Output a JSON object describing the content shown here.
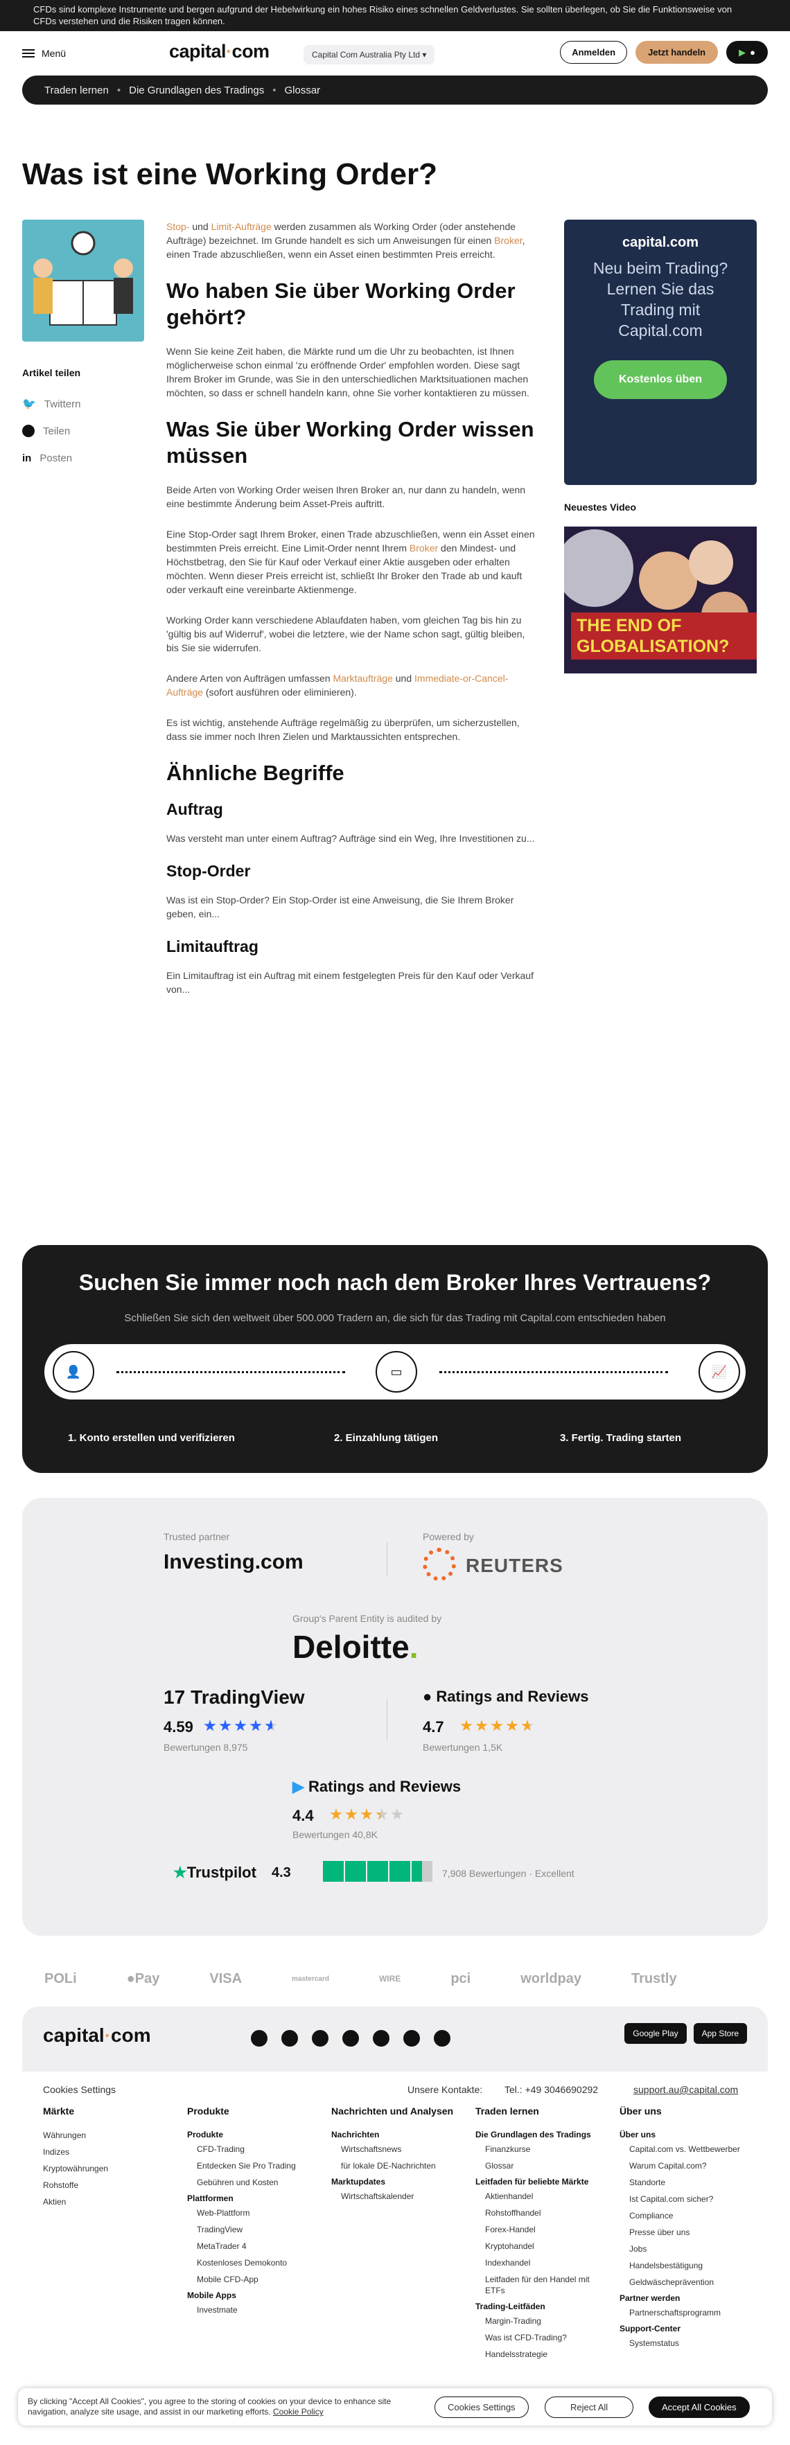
{
  "risk_banner": "CFDs sind komplexe Instrumente und bergen aufgrund der Hebelwirkung ein hohes Risiko eines schnellen Geldverlustes. Sie sollten überlegen, ob Sie die Funktionsweise von CFDs verstehen und die Risiken tragen können.",
  "nav": {
    "menu": "Menü",
    "logo": "capital",
    "logo_tail": "com",
    "entity": "Capital Com Australia Pty Ltd",
    "login": "Anmelden",
    "trade": "Jetzt handeln"
  },
  "breadcrumb": [
    "Traden lernen",
    "Die Grundlagen des Tradings",
    "Glossar"
  ],
  "title": "Was ist eine Working Order?",
  "share": {
    "heading": "Artikel teilen",
    "twitter": "Twittern",
    "facebook": "Teilen",
    "linkedin": "Posten"
  },
  "article": {
    "intro_a": "Stop-",
    "intro_b": " und ",
    "intro_c": "Limit-Aufträge",
    "intro_d": " werden zusammen als Working Order (oder anstehende Aufträge) bezeichnet. Im Grunde handelt es sich um Anweisungen für einen ",
    "intro_e": "Broker",
    "intro_f": ", einen Trade abzuschließen, wenn ein Asset einen bestimmten Preis erreicht.",
    "h2_1": "Wo haben Sie über Working Order gehört?",
    "p1": "Wenn Sie keine Zeit haben, die Märkte rund um die Uhr zu beobachten, ist Ihnen möglicherweise schon einmal 'zu eröffnende Order' empfohlen worden. Diese sagt Ihrem Broker im Grunde, was Sie in den unterschiedlichen Marktsituationen machen möchten, so dass er schnell handeln kann, ohne Sie vorher kontaktieren zu müssen.",
    "h2_2": "Was Sie über Working Order wissen müssen",
    "p2": "Beide Arten von Working Order weisen Ihren Broker an, nur dann zu handeln, wenn eine bestimmte Änderung beim Asset-Preis auftritt.",
    "p3a": "Eine Stop-Order sagt Ihrem Broker, einen Trade abzuschließen, wenn ein Asset einen bestimmten Preis erreicht. Eine Limit-Order nennt Ihrem ",
    "p3b": "Broker",
    "p3c": " den Mindest- und Höchstbetrag, den Sie für Kauf oder Verkauf einer Aktie ausgeben oder erhalten möchten. Wenn dieser Preis erreicht ist, schließt Ihr Broker den Trade ab und kauft oder verkauft eine vereinbarte Aktienmenge.",
    "p4": "Working Order kann verschiedene Ablaufdaten haben, vom gleichen Tag bis hin zu 'gültig bis auf Widerruf', wobei die letztere, wie der Name schon sagt, gültig bleiben, bis Sie sie widerrufen.",
    "p5a": "Andere Arten von Aufträgen umfassen ",
    "p5b": "Marktaufträge",
    "p5c": " und ",
    "p5d": "Immediate-or-Cancel-Aufträge",
    "p5e": " (sofort ausführen oder eliminieren).",
    "p6": "Es ist wichtig, anstehende Aufträge regelmäßig zu überprüfen, um sicherzustellen, dass sie immer noch Ihren Zielen und Marktaussichten entsprechen.",
    "h2_3": "Ähnliche Begriffe",
    "terms": [
      {
        "t": "Auftrag",
        "d": "Was versteht man unter einem Auftrag? Aufträge sind ein Weg, Ihre Investitionen zu..."
      },
      {
        "t": "Stop-Order",
        "d": "Was ist ein Stop-Order? Ein Stop-Order ist eine Anweisung, die Sie Ihrem Broker geben, ein..."
      },
      {
        "t": "Limitauftrag",
        "d": "Ein Limitauftrag ist ein Auftrag mit einem festgelegten Preis für den Kauf oder Verkauf von..."
      }
    ]
  },
  "promo": {
    "logo": "capital.com",
    "text": "Neu beim Trading? Lernen Sie das Trading mit Capital.com",
    "button": "Kostenlos üben"
  },
  "video": {
    "heading": "Neuestes Video",
    "title": "THE END OF GLOBALISATION?"
  },
  "broker": {
    "title": "Suchen Sie immer noch nach dem Broker Ihres Vertrauens?",
    "sub": "Schließen Sie sich den weltweit über 500.000 Tradern an, die sich für das Trading mit Capital.com entschieden haben",
    "steps": [
      "1. Konto erstellen und verifizieren",
      "2. Einzahlung tätigen",
      "3. Fertig. Trading starten"
    ]
  },
  "trust": {
    "trusted": "Trusted partner",
    "investing": "Investing.com",
    "powered": "Powered by",
    "reuters": "REUTERS",
    "audited": "Group's Parent Entity is audited by",
    "deloitte": "Deloitte",
    "tv": {
      "name": "TradingView",
      "score": "4.59",
      "count": "Bewertungen 8,975"
    },
    "apple": {
      "name": "Ratings and Reviews",
      "score": "4.7",
      "count": "Bewertungen 1,5K"
    },
    "google": {
      "name": "Ratings and Reviews",
      "score": "4.4",
      "count": "Bewertungen 40,8K"
    },
    "trustpilot": {
      "name": "Trustpilot",
      "score": "4.3",
      "count": "7,908 Bewertungen",
      "label": "Excellent"
    }
  },
  "payments": [
    "POLi",
    "Pay",
    "VISA",
    "mastercard",
    "WIRE",
    "pci",
    "worldpay",
    "Trustly"
  ],
  "footer": {
    "logo": "capital",
    "logo_tail": "com",
    "stores": [
      "Google Play",
      "App Store"
    ],
    "cookie_settings": "Cookies Settings",
    "contacts": "Unsere Kontakte:",
    "phone": "Tel.: +49 3046690292",
    "email": "support.au@capital.com",
    "cols": [
      {
        "h": "Märkte",
        "items": [
          {
            "t": "Währungen"
          },
          {
            "t": "Indizes"
          },
          {
            "t": "Kryptowährungen"
          },
          {
            "t": "Rohstoffe"
          },
          {
            "t": "Aktien"
          }
        ]
      },
      {
        "h": "Produkte",
        "items": [
          {
            "t": "Produkte",
            "s": true
          },
          {
            "t": "CFD-Trading",
            "i": true
          },
          {
            "t": "Entdecken Sie Pro Trading",
            "i": true
          },
          {
            "t": "Gebühren und Kosten",
            "i": true
          },
          {
            "t": "Plattformen",
            "s": true
          },
          {
            "t": "Web-Plattform",
            "i": true
          },
          {
            "t": "TradingView",
            "i": true
          },
          {
            "t": "MetaTrader 4",
            "i": true
          },
          {
            "t": "Kostenloses Demokonto",
            "i": true
          },
          {
            "t": "Mobile CFD-App",
            "i": true
          },
          {
            "t": "Mobile Apps",
            "s": true
          },
          {
            "t": "Investmate",
            "i": true
          }
        ]
      },
      {
        "h": "Nachrichten und Analysen",
        "items": [
          {
            "t": "Nachrichten",
            "s": true
          },
          {
            "t": "Wirtschaftsnews",
            "i": true
          },
          {
            "t": "für lokale DE-Nachrichten",
            "i": true
          },
          {
            "t": "Marktupdates",
            "s": true
          },
          {
            "t": "Wirtschaftskalender",
            "i": true
          }
        ]
      },
      {
        "h": "Traden lernen",
        "items": [
          {
            "t": "Die Grundlagen des Tradings",
            "s": true
          },
          {
            "t": "Finanzkurse",
            "i": true
          },
          {
            "t": "Glossar",
            "i": true
          },
          {
            "t": "Leitfaden für beliebte Märkte",
            "s": true
          },
          {
            "t": "Aktienhandel",
            "i": true
          },
          {
            "t": "Rohstoffhandel",
            "i": true
          },
          {
            "t": "Forex-Handel",
            "i": true
          },
          {
            "t": "Kryptohandel",
            "i": true
          },
          {
            "t": "Indexhandel",
            "i": true
          },
          {
            "t": "Leitfaden für den Handel mit ETFs",
            "i": true
          },
          {
            "t": "Trading-Leitfäden",
            "s": true
          },
          {
            "t": "Margin-Trading",
            "i": true
          },
          {
            "t": "Was ist CFD-Trading?",
            "i": true
          },
          {
            "t": "Handelsstrategie",
            "i": true
          }
        ]
      },
      {
        "h": "Über uns",
        "items": [
          {
            "t": "Über uns",
            "s": true
          },
          {
            "t": "Capital.com vs. Wettbewerber",
            "i": true
          },
          {
            "t": "Warum Capital.com?",
            "i": true
          },
          {
            "t": "Standorte",
            "i": true
          },
          {
            "t": "Ist Capital.com sicher?",
            "i": true
          },
          {
            "t": "Compliance",
            "i": true
          },
          {
            "t": "Presse über uns",
            "i": true
          },
          {
            "t": "Jobs",
            "i": true
          },
          {
            "t": "Handelsbestätigung",
            "i": true
          },
          {
            "t": "Geldwäscheprävention",
            "i": true
          },
          {
            "t": "Partner werden",
            "s": true
          },
          {
            "t": "Partnerschaftsprogramm",
            "i": true
          },
          {
            "t": "Support-Center",
            "s": true
          },
          {
            "t": "Systemstatus",
            "i": true
          }
        ]
      }
    ]
  },
  "cookie": {
    "text": "By clicking \"Accept All Cookies\", you agree to the storing of cookies on your device to enhance site navigation, analyze site usage, and assist in our marketing efforts.",
    "policy": "Cookie Policy",
    "settings": "Cookies Settings",
    "reject": "Reject All",
    "accept": "Accept All Cookies"
  },
  "colors": {
    "accent": "#d9a373",
    "link": "#d08a4a",
    "promo_bg": "#1e2d4a",
    "green": "#63c35b",
    "dark": "#1b1b1b"
  }
}
